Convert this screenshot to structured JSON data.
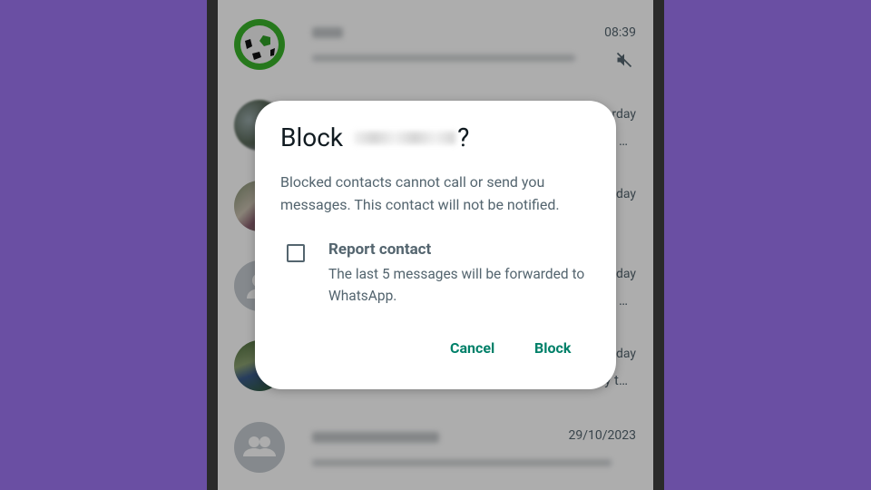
{
  "background_color": "#6a4fa3",
  "chat_list": [
    {
      "time": "08:39",
      "muted": true,
      "avatar": "soccer-ball"
    },
    {
      "time": "Yesterday",
      "visible_time": "rday",
      "preview_suffix": "…",
      "avatar": "photo"
    },
    {
      "time": "Yesterday",
      "visible_time": "day",
      "avatar": "photo"
    },
    {
      "time": "Yesterday",
      "visible_time": "day",
      "preview_suffix": "…",
      "avatar": "default-person"
    },
    {
      "time": "Yesterday",
      "visible_time": "day",
      "preview_suffix": "y t…",
      "avatar": "photo"
    },
    {
      "time": "29/10/2023",
      "avatar": "default-group"
    }
  ],
  "dialog": {
    "title_prefix": "Block",
    "title_suffix": "?",
    "body": "Blocked contacts cannot call or send you messages. This contact will not be notified.",
    "report_checkbox": {
      "checked": false,
      "label": "Report contact",
      "description": "The last 5 messages will be forwarded to WhatsApp."
    },
    "cancel_label": "Cancel",
    "confirm_label": "Block",
    "accent_color": "#008069"
  }
}
